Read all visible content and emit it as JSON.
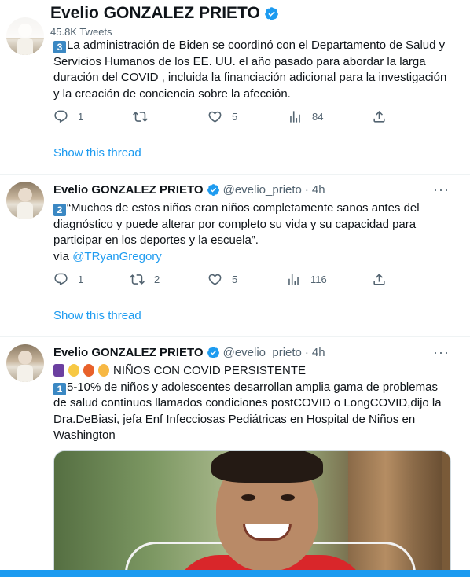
{
  "header": {
    "name": "Evelio GONZALEZ PRIETO",
    "tweet_count": "45.8K Tweets"
  },
  "colors": {
    "accent": "#1d9bf0",
    "text": "#0f1419",
    "secondary": "#536471",
    "divider": "#eff3f4"
  },
  "tweets": [
    {
      "keycap": "3",
      "lines": [
        "La administración de Biden se coordinó con el  Departamento de Salud y",
        "Servicios Humanos de los EE. UU. el año pasado para abordar la larga",
        "duración del COVID , incluida la financiación adicional para la investigación",
        "y la creación de conciencia sobre la afección."
      ],
      "replies": "1",
      "retweets": "",
      "likes": "5",
      "views": "84",
      "show_thread": "Show this thread"
    },
    {
      "name": "Evelio GONZALEZ PRIETO",
      "handle": "@evelio_prieto",
      "sep": "·",
      "time": "4h",
      "more": "···",
      "keycap": "2",
      "lines": [
        "“Muchos de estos niños eran niños completamente sanos antes del",
        "diagnóstico y puede alterar por completo su vida y su capacidad para",
        "participar en los deportes y la escuela”."
      ],
      "via_prefix": "vía ",
      "via_link": "@TRyanGregory",
      "replies": "1",
      "retweets": "2",
      "likes": "5",
      "views": "116",
      "show_thread": "Show this thread"
    },
    {
      "name": "Evelio GONZALEZ PRIETO",
      "handle": "@evelio_prieto",
      "sep": "·",
      "time": "4h",
      "more": "···",
      "headline": "NIÑOS CON COVID PERSISTENTE",
      "keycap": "1",
      "lines": [
        "5-10% de niños y adolescentes desarrollan amplia gama de problemas",
        "de salud continuos llamados condiciones postCOVID o LongCOVID,dijo la",
        "Dra.DeBiasi, jefa Enf Infecciosas Pediátricas en Hospital de Niños en",
        "Washington"
      ]
    }
  ]
}
